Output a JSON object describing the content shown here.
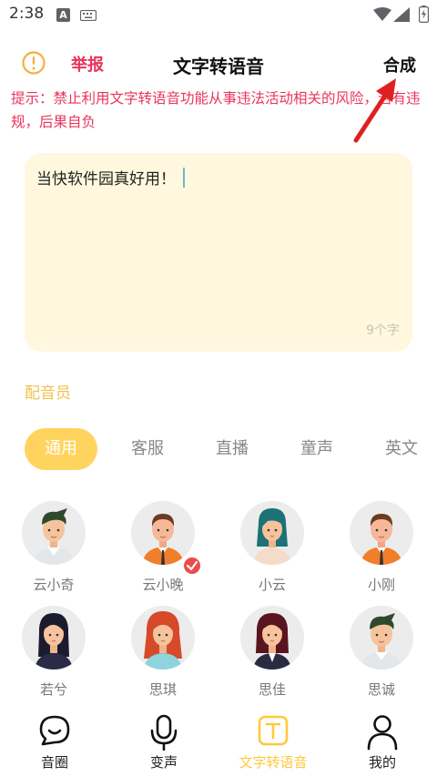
{
  "status_bar": {
    "time": "2:38",
    "a_badge": "A"
  },
  "header": {
    "report_label": "举报",
    "title": "文字转语音",
    "synthesize_label": "合成"
  },
  "notice": "提示：禁止利用文字转语音功能从事违法活动相关的风险，若有违规，后果自负",
  "editor": {
    "text": "当快软件园真好用！",
    "char_count": "9个字"
  },
  "section_label": "配音员",
  "tabs": [
    {
      "label": "通用",
      "active": true
    },
    {
      "label": "客服",
      "active": false
    },
    {
      "label": "直播",
      "active": false
    },
    {
      "label": "童声",
      "active": false
    },
    {
      "label": "英文",
      "active": false
    }
  ],
  "voices": [
    {
      "name": "云小奇",
      "selected": false
    },
    {
      "name": "云小晚",
      "selected": true
    },
    {
      "name": "小云",
      "selected": false
    },
    {
      "name": "小刚",
      "selected": false
    },
    {
      "name": "若兮",
      "selected": false
    },
    {
      "name": "思琪",
      "selected": false
    },
    {
      "name": "思佳",
      "selected": false
    },
    {
      "name": "思诚",
      "selected": false
    }
  ],
  "nav": [
    {
      "label": "音圈",
      "icon": "chat-bubble-icon",
      "active": false
    },
    {
      "label": "变声",
      "icon": "microphone-icon",
      "active": false
    },
    {
      "label": "文字转语音",
      "icon": "text-t-icon",
      "active": true
    },
    {
      "label": "我的",
      "icon": "user-icon",
      "active": false
    }
  ],
  "colors": {
    "accent_yellow": "#ffd45e",
    "report_red": "#e8335d",
    "card_bg": "#fff8df",
    "check_red": "#ec4b4b"
  }
}
